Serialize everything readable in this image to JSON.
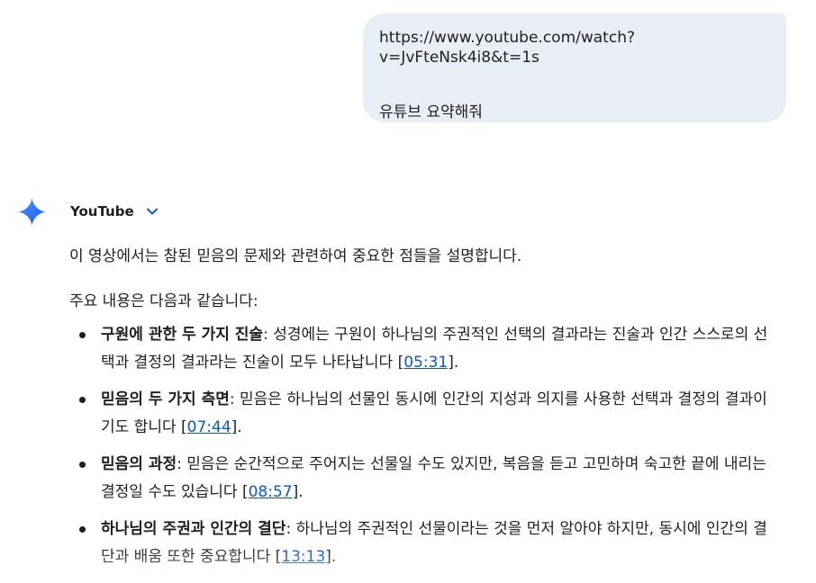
{
  "user_message": {
    "url": "https://www.youtube.com/watch?v=JvFteNsk4i8&t=1s",
    "request": "유튜브 요약해줘"
  },
  "assistant": {
    "source_label": "YouTube",
    "icon": "gemini-sparkle-icon",
    "intro": "이 영상에서는 참된 믿음의 문제와 관련하여 중요한 점들을 설명합니다.",
    "lead": "주요 내용은 다음과 같습니다:",
    "points": [
      {
        "title": "구원에 관한 두 가지 진술",
        "text_before": ": 성경에는 구원이 하나님의 주권적인 선택의 결과라는 진술과 인간 스스로의 선택과 결정의 결과라는 진술이 모두 나타납니다 [",
        "timestamp": "05:31",
        "text_after": "]."
      },
      {
        "title": "믿음의 두 가지 측면",
        "text_before": ": 믿음은 하나님의 선물인 동시에 인간의 지성과 의지를 사용한 선택과 결정의 결과이기도 합니다 [",
        "timestamp": "07:44",
        "text_after": "]."
      },
      {
        "title": "믿음의 과정",
        "text_before": ": 믿음은 순간적으로 주어지는 선물일 수도 있지만, 복음을 듣고 고민하며 숙고한 끝에 내리는 결정일 수도 있습니다 [",
        "timestamp": "08:57",
        "text_after": "]."
      },
      {
        "title": "하나님의 주권과 인간의 결단",
        "text_before": ": 하나님의 주권적인 선물이라는 것을 먼저 알아야 하지만, 동시에 인간의 결단과 배움 또한 중요합니다 [",
        "timestamp": "13:13",
        "text_after": "]."
      }
    ]
  },
  "colors": {
    "bubble_bg": "#e9eef6",
    "link": "#0b57d0",
    "text": "#1f1f1f"
  }
}
